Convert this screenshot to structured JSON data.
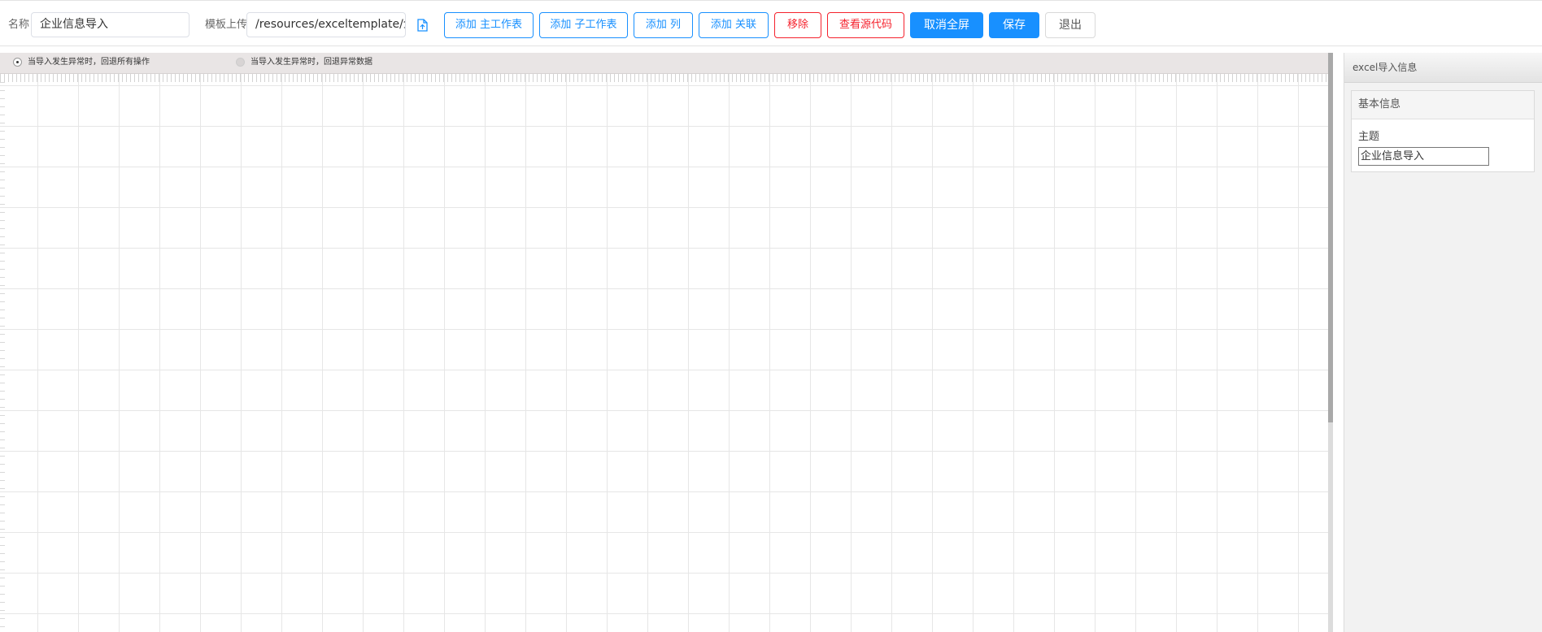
{
  "toolbar": {
    "name_label": "名称",
    "name_value": "企业信息导入",
    "template_label": "模板上传",
    "template_value": "/resources/exceltemplate/企业",
    "upload_icon": "file-upload-icon",
    "buttons": {
      "add_main_sheet": "添加 主工作表",
      "add_sub_sheet": "添加 子工作表",
      "add_column": "添加 列",
      "add_relation": "添加 关联",
      "remove": "移除",
      "view_source": "查看源代码",
      "exit_fullscreen": "取消全屏",
      "save": "保存",
      "quit": "退出"
    }
  },
  "options": {
    "rollback_all": "当导入发生异常时，回退所有操作",
    "rollback_error": "当导入发生异常时，回退异常数据",
    "selected": "rollback_all"
  },
  "panel": {
    "title": "excel导入信息",
    "section_title": "基本信息",
    "subject_label": "主题",
    "subject_value": "企业信息导入"
  },
  "colors": {
    "primary": "#1890ff",
    "danger": "#f5222d",
    "grid_line": "#e6e6e6"
  }
}
